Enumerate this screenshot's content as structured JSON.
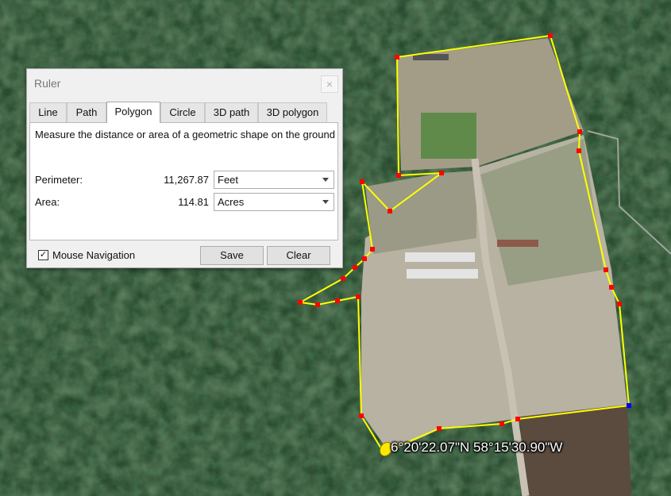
{
  "dialog": {
    "title": "Ruler",
    "close_glyph": "×",
    "tabs": [
      {
        "label": "Line"
      },
      {
        "label": "Path"
      },
      {
        "label": "Polygon"
      },
      {
        "label": "Circle"
      },
      {
        "label": "3D path"
      },
      {
        "label": "3D polygon"
      }
    ],
    "active_tab": "Polygon",
    "description": "Measure the distance or area of a geometric shape on the ground",
    "perimeter": {
      "label": "Perimeter:",
      "value": "11,267.87",
      "unit": "Feet"
    },
    "area": {
      "label": "Area:",
      "value": "114.81",
      "unit": "Acres"
    },
    "mouse_navigation": {
      "label": "Mouse Navigation",
      "checked": true,
      "check_glyph": "✓"
    },
    "save_label": "Save",
    "clear_label": "Clear"
  },
  "map": {
    "coordinate_readout": "6°20'22.07\"N 58°15'30.90\"W",
    "polygon_color": "#ffff00",
    "vertex_color": "#ff0000",
    "active_vertex_color": "#0000ff",
    "pin_color": "#ffe800"
  }
}
